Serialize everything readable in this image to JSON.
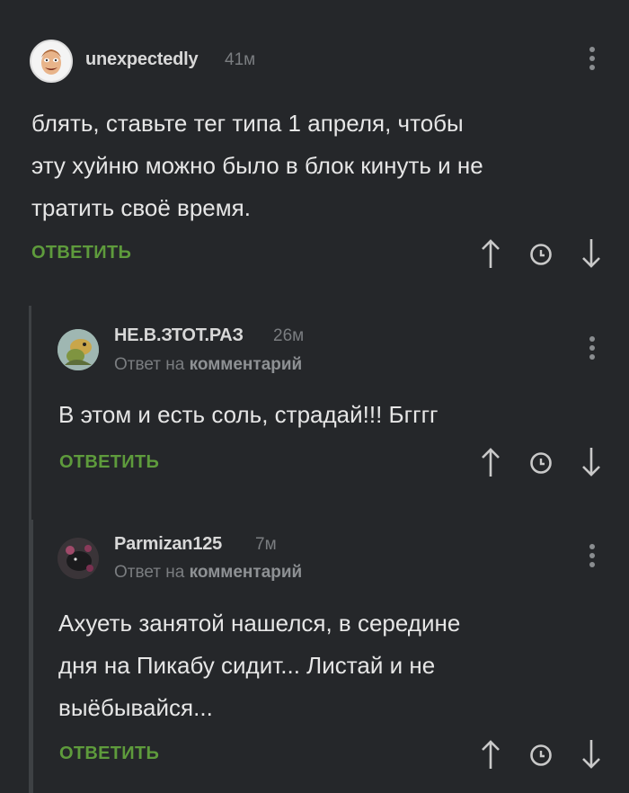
{
  "comments": [
    {
      "username": "unexpectedly",
      "time": "41м",
      "reply_to": null,
      "text": "блять, ставьте тег типа 1 апреля, чтобы\nэту хуйню можно было в блок кинуть и не\nтратить своё время.",
      "reply_label": "ОТВЕТИТЬ"
    },
    {
      "username": "НЕ.В.ЗТОТ.РАЗ",
      "time": "26м",
      "reply_to": {
        "prefix": "Ответ на",
        "target": "комментарий"
      },
      "text": "В этом и есть соль, страдай!!! Бгггг",
      "reply_label": "ОТВЕТИТЬ"
    },
    {
      "username": "Parmizan125",
      "time": "7м",
      "reply_to": {
        "prefix": "Ответ на",
        "target": "комментарий"
      },
      "text": "Ахуеть занятой нашелся, в середине\nдня на Пикабу сидит... Листай и не\nвыёбывайся...",
      "reply_label": "ОТВЕТИТЬ"
    }
  ],
  "icons": {
    "menu": "kebab-menu-icon",
    "upvote": "arrow-up-icon",
    "history": "clock-icon",
    "downvote": "arrow-down-icon"
  },
  "colors": {
    "background": "#25272a",
    "reply_green": "#5e9b3c",
    "muted": "#7a7d80",
    "thread_line": "#3e4144"
  }
}
